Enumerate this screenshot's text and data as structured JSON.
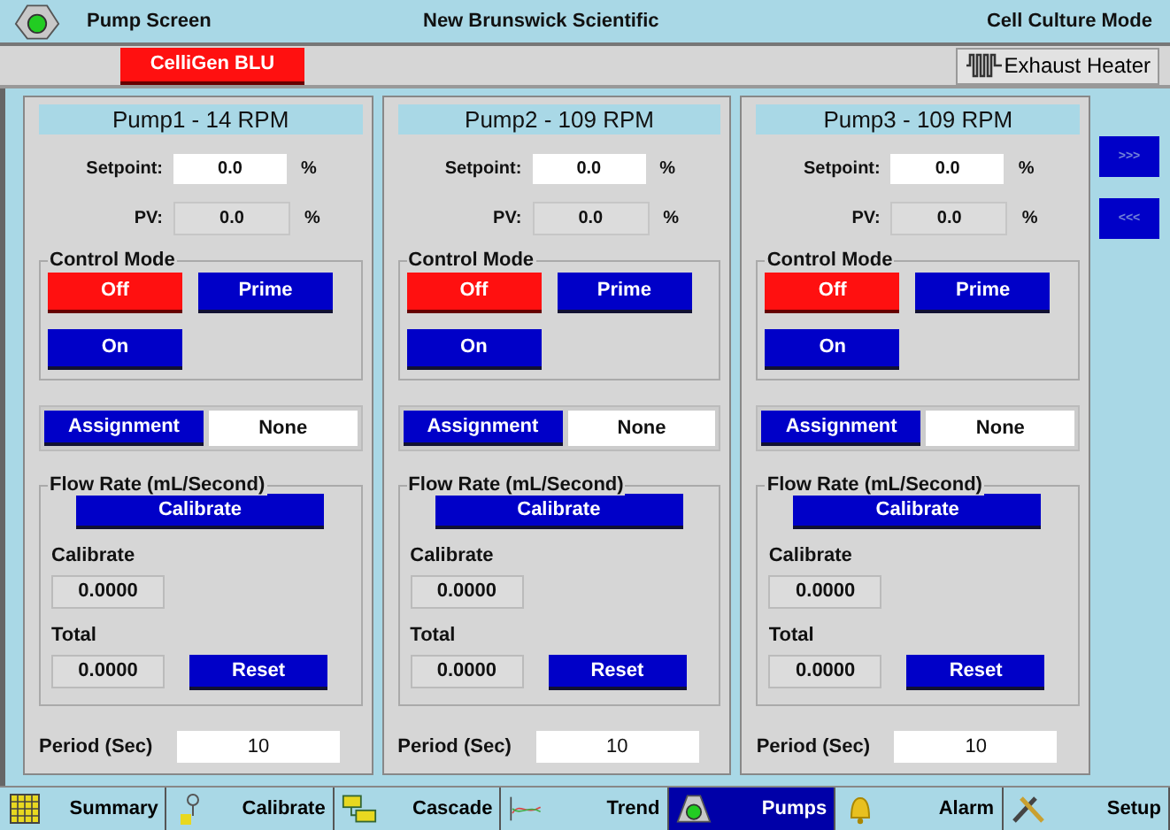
{
  "header": {
    "title": "Pump Screen",
    "company": "New Brunswick Scientific",
    "mode": "Cell Culture Mode"
  },
  "toolbar": {
    "unit_button": "CelliGen BLU",
    "heater_button": "Exhaust Heater"
  },
  "pumps": [
    {
      "title": "Pump1 - 14 RPM",
      "setpoint_label": "Setpoint:",
      "setpoint": "0.0",
      "setpoint_unit": "%",
      "pv_label": "PV:",
      "pv": "0.0",
      "pv_unit": "%",
      "control_mode_label": "Control Mode",
      "modes": [
        {
          "label": "Off",
          "selected": true
        },
        {
          "label": "Prime",
          "selected": false
        },
        {
          "label": "On",
          "selected": false
        }
      ],
      "assignment_button": "Assignment",
      "assignment": "None",
      "flow_label": "Flow Rate (mL/Second)",
      "calibrate_button": "Calibrate",
      "calibrate_label": "Calibrate",
      "calibrate_value": "0.0000",
      "total_label": "Total",
      "total_value": "0.0000",
      "reset_button": "Reset",
      "period_label": "Period (Sec)",
      "period": "10"
    },
    {
      "title": "Pump2 - 109 RPM",
      "setpoint_label": "Setpoint:",
      "setpoint": "0.0",
      "setpoint_unit": "%",
      "pv_label": "PV:",
      "pv": "0.0",
      "pv_unit": "%",
      "control_mode_label": "Control Mode",
      "modes": [
        {
          "label": "Off",
          "selected": true
        },
        {
          "label": "Prime",
          "selected": false
        },
        {
          "label": "On",
          "selected": false
        }
      ],
      "assignment_button": "Assignment",
      "assignment": "None",
      "flow_label": "Flow Rate (mL/Second)",
      "calibrate_button": "Calibrate",
      "calibrate_label": "Calibrate",
      "calibrate_value": "0.0000",
      "total_label": "Total",
      "total_value": "0.0000",
      "reset_button": "Reset",
      "period_label": "Period (Sec)",
      "period": "10"
    },
    {
      "title": "Pump3 - 109 RPM",
      "setpoint_label": "Setpoint:",
      "setpoint": "0.0",
      "setpoint_unit": "%",
      "pv_label": "PV:",
      "pv": "0.0",
      "pv_unit": "%",
      "control_mode_label": "Control Mode",
      "modes": [
        {
          "label": "Off",
          "selected": true
        },
        {
          "label": "Prime",
          "selected": false
        },
        {
          "label": "On",
          "selected": false
        }
      ],
      "assignment_button": "Assignment",
      "assignment": "None",
      "flow_label": "Flow Rate (mL/Second)",
      "calibrate_button": "Calibrate",
      "calibrate_label": "Calibrate",
      "calibrate_value": "0.0000",
      "total_label": "Total",
      "total_value": "0.0000",
      "reset_button": "Reset",
      "period_label": "Period (Sec)",
      "period": "10"
    }
  ],
  "page_buttons": [
    ">>>",
    "<<<"
  ],
  "tabs": [
    {
      "label": "Summary",
      "kind": "grid",
      "selected": false
    },
    {
      "label": "Calibrate",
      "kind": "probe",
      "selected": false
    },
    {
      "label": "Cascade",
      "kind": "cascade",
      "selected": false
    },
    {
      "label": "Trend",
      "kind": "trend",
      "selected": false
    },
    {
      "label": "Pumps",
      "kind": "pump",
      "selected": true
    },
    {
      "label": "Alarm",
      "kind": "bell",
      "selected": false
    },
    {
      "label": "Setup",
      "kind": "tools",
      "selected": false
    }
  ]
}
